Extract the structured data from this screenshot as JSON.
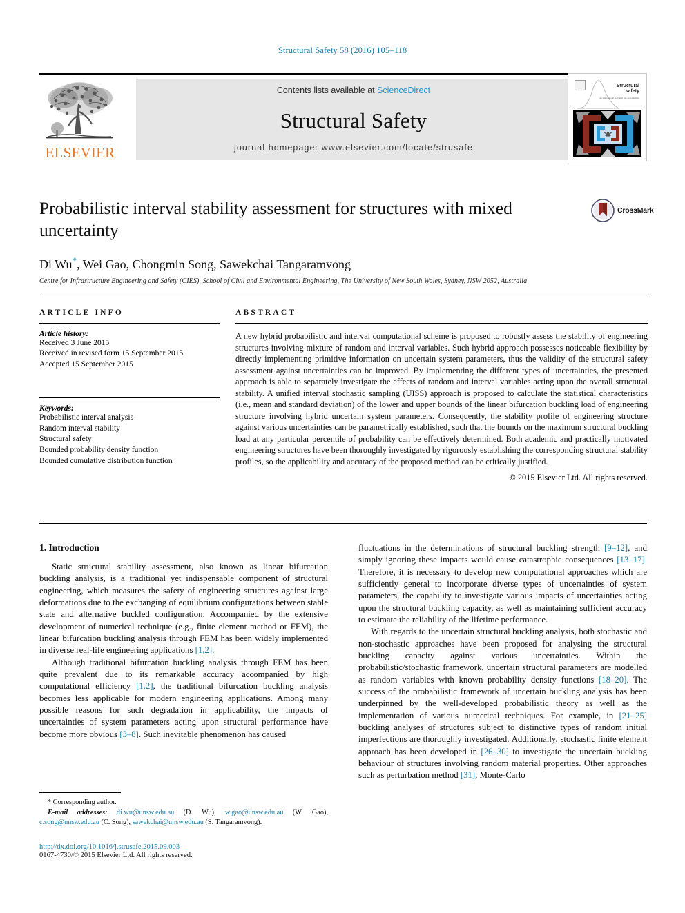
{
  "running_head": "Structural Safety 58 (2016) 105–118",
  "masthead": {
    "contents_prefix": "Contents lists available at ",
    "sciencedirect": "ScienceDirect",
    "journal_title": "Structural Safety",
    "homepage": "journal homepage: www.elsevier.com/locate/strusafe",
    "publisher_name": "ELSEVIER",
    "cover_title_line1": "Structural",
    "cover_title_line2": "safety",
    "cover_subtitle": "an international journal of risk and reliability"
  },
  "article": {
    "title": "Probabilistic interval stability assessment for structures with mixed uncertainty",
    "authors": "Di Wu , Wei Gao, Chongmin Song, Sawekchai Tangaramvong",
    "author_star": "*",
    "affiliation": "Centre for Infrastructure Engineering and Safety (CIES), School of Civil and Environmental Engineering, The University of New South Wales, Sydney, NSW 2052, Australia",
    "crossmark_label": "CrossMark"
  },
  "info": {
    "heading": "ARTICLE INFO",
    "history_label": "Article history:",
    "history": [
      "Received 3 June 2015",
      "Received in revised form 15 September 2015",
      "Accepted 15 September 2015"
    ],
    "keywords_label": "Keywords:",
    "keywords": [
      "Probabilistic interval analysis",
      "Random interval stability",
      "Structural safety",
      "Bounded probability density function",
      "Bounded cumulative distribution function"
    ]
  },
  "abstract": {
    "heading": "ABSTRACT",
    "text": "A new hybrid probabilistic and interval computational scheme is proposed to robustly assess the stability of engineering structures involving mixture of random and interval variables. Such hybrid approach possesses noticeable flexibility by directly implementing primitive information on uncertain system parameters, thus the validity of the structural safety assessment against uncertainties can be improved. By implementing the different types of uncertainties, the presented approach is able to separately investigate the effects of random and interval variables acting upon the overall structural stability. A unified interval stochastic sampling (UISS) approach is proposed to calculate the statistical characteristics (i.e., mean and standard deviation) of the lower and upper bounds of the linear bifurcation buckling load of engineering structure involving hybrid uncertain system parameters. Consequently, the stability profile of engineering structure against various uncertainties can be parametrically established, such that the bounds on the maximum structural buckling load at any particular percentile of probability can be effectively determined. Both academic and practically motivated engineering structures have been thoroughly investigated by rigorously establishing the corresponding structural stability profiles, so the applicability and accuracy of the proposed method can be critically justified.",
    "copyright": "© 2015 Elsevier Ltd. All rights reserved."
  },
  "body": {
    "section_heading": "1. Introduction",
    "left": [
      {
        "id": "p1",
        "segments": [
          {
            "t": "Static structural stability assessment, also known as linear bifurcation buckling analysis, is a traditional yet indispensable component of structural engineering, which measures the safety of engineering structures against large deformations due to the exchanging of equilibrium configurations between stable state and alternative buckled configuration. Accompanied by the extensive development of numerical technique (e.g., finite element method or FEM), the linear bifurcation buckling analysis through FEM has been widely implemented in diverse real-life engineering applications ",
            "k": "plain"
          },
          {
            "t": "[1,2]",
            "k": "ref"
          },
          {
            "t": ".",
            "k": "plain"
          }
        ]
      },
      {
        "id": "p2",
        "segments": [
          {
            "t": "Although traditional bifurcation buckling analysis through FEM has been quite prevalent due to its remarkable accuracy accompanied by high computational efficiency ",
            "k": "plain"
          },
          {
            "t": "[1,2]",
            "k": "ref"
          },
          {
            "t": ", the traditional bifurcation buckling analysis becomes less applicable for modern engineering applications. Among many possible reasons for such degradation in applicability, the impacts of uncertainties of system parameters acting upon structural performance have become more obvious ",
            "k": "plain"
          },
          {
            "t": "[3–8]",
            "k": "ref"
          },
          {
            "t": ". Such inevitable phenomenon has caused",
            "k": "plain"
          }
        ]
      }
    ],
    "right": [
      {
        "id": "p3",
        "segments": [
          {
            "t": "fluctuations in the determinations of structural buckling strength ",
            "k": "plain"
          },
          {
            "t": "[9–12]",
            "k": "ref"
          },
          {
            "t": ", and simply ignoring these impacts would cause catastrophic consequences ",
            "k": "plain"
          },
          {
            "t": "[13–17]",
            "k": "ref"
          },
          {
            "t": ". Therefore, it is necessary to develop new computational approaches which are sufficiently general to incorporate diverse types of uncertainties of system parameters, the capability to investigate various impacts of uncertainties acting upon the structural buckling capacity, as well as maintaining sufficient accuracy to estimate the reliability of the lifetime performance.",
            "k": "plain"
          }
        ],
        "no_indent": true
      },
      {
        "id": "p4",
        "segments": [
          {
            "t": "With regards to the uncertain structural buckling analysis, both stochastic and non-stochastic approaches have been proposed for analysing the structural buckling capacity against various uncertainties. Within the probabilistic/stochastic framework, uncertain structural parameters are modelled as random variables with known probability density functions ",
            "k": "plain"
          },
          {
            "t": "[18–20]",
            "k": "ref"
          },
          {
            "t": ". The success of the probabilistic framework of uncertain buckling analysis has been underpinned by the well-developed probabilistic theory as well as the implementation of various numerical techniques. For example, in ",
            "k": "plain"
          },
          {
            "t": "[21–25]",
            "k": "ref"
          },
          {
            "t": " buckling analyses of structures subject to distinctive types of random initial imperfections are thoroughly investigated. Additionally, stochastic finite element approach has been developed in ",
            "k": "plain"
          },
          {
            "t": "[26–30]",
            "k": "ref"
          },
          {
            "t": " to investigate the uncertain buckling behaviour of structures involving random material properties. Other approaches such as perturbation method ",
            "k": "plain"
          },
          {
            "t": "[31]",
            "k": "ref"
          },
          {
            "t": ", Monte-Carlo",
            "k": "plain"
          }
        ]
      }
    ]
  },
  "footnote": {
    "corresponding_star": "*",
    "corresponding_text": "Corresponding author.",
    "email_label": "E-mail addresses:",
    "emails": [
      {
        "address": "di.wu@unsw.edu.au",
        "name": "(D. Wu)"
      },
      {
        "address": "w.gao@unsw.edu.au",
        "name": "(W. Gao)"
      },
      {
        "address": "c.song@unsw.edu.au",
        "name": "(C. Song)"
      },
      {
        "address": "sawekchai@unsw.edu.au",
        "name": "(S. Tangaramvong)"
      }
    ],
    "doi": "http://dx.doi.org/10.1016/j.strusafe.2015.09.003",
    "issn_line": "0167-4730/© 2015 Elsevier Ltd. All rights reserved."
  },
  "colors": {
    "link_blue": "#1b7fa8",
    "sciencedirect_blue": "#1b9bd1",
    "elsevier_orange": "#e87722",
    "banner_grey": "#e6e6e6",
    "cover_red": "#8c2b20",
    "cover_blue": "#2f9bd4"
  }
}
